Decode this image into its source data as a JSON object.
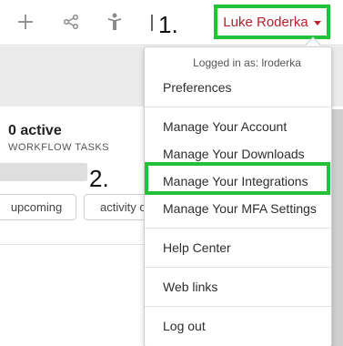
{
  "steps": {
    "first": "1.",
    "second": "2."
  },
  "toolbar": {
    "icons": [
      "plus-icon",
      "share-icon",
      "person-icon"
    ],
    "user_name": "Luke Roderka"
  },
  "dashboard": {
    "active_count": "0 active",
    "active_label": "WORKFLOW TASKS",
    "filters": [
      "upcoming",
      "activity o"
    ]
  },
  "user_menu": {
    "logged_in_as": "Logged in as: lroderka",
    "items": [
      "Preferences",
      "Manage Your Account",
      "Manage Your Downloads",
      "Manage Your Integrations",
      "Manage Your MFA Settings",
      "Help Center",
      "Web links",
      "Log out"
    ],
    "highlighted": "Manage Your Integrations"
  },
  "colors": {
    "highlight": "#22c13a",
    "accent": "#b8202e"
  }
}
